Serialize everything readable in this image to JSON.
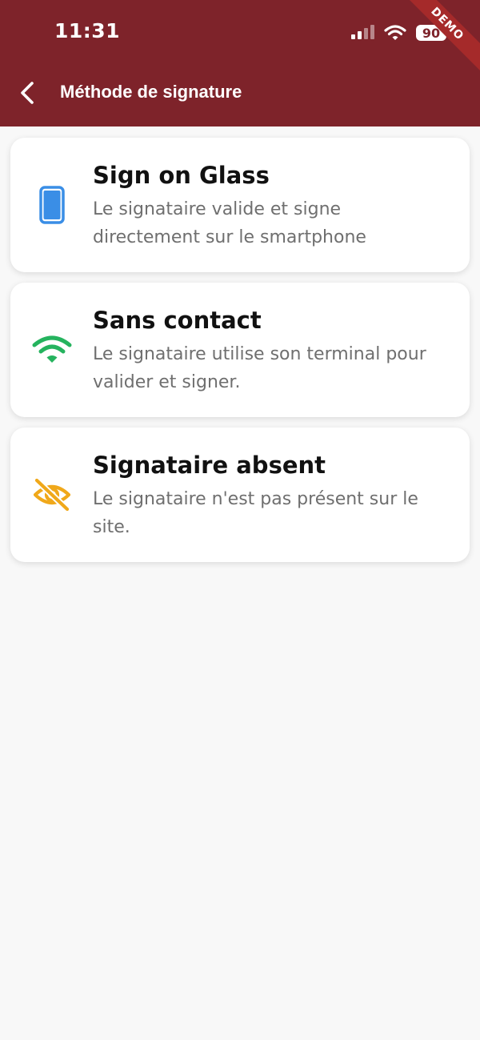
{
  "status_bar": {
    "time": "11:31",
    "battery": "90"
  },
  "ribbon": {
    "label": "DEMO"
  },
  "header": {
    "title": "Méthode de signature"
  },
  "methods": [
    {
      "title": "Sign on Glass",
      "description": "Le signataire valide et signe directement sur le smartphone",
      "icon": "smartphone-icon",
      "color": "#3a8ee6"
    },
    {
      "title": "Sans contact",
      "description": "Le signataire utilise son terminal pour valider et signer.",
      "icon": "wifi-icon",
      "color": "#25b35e"
    },
    {
      "title": "Signataire absent",
      "description": "Le signataire n'est pas présent sur le site.",
      "icon": "eye-off-icon",
      "color": "#f0a81a"
    }
  ],
  "colors": {
    "app_bar": "#7e232a",
    "background": "#f8f8f8"
  }
}
